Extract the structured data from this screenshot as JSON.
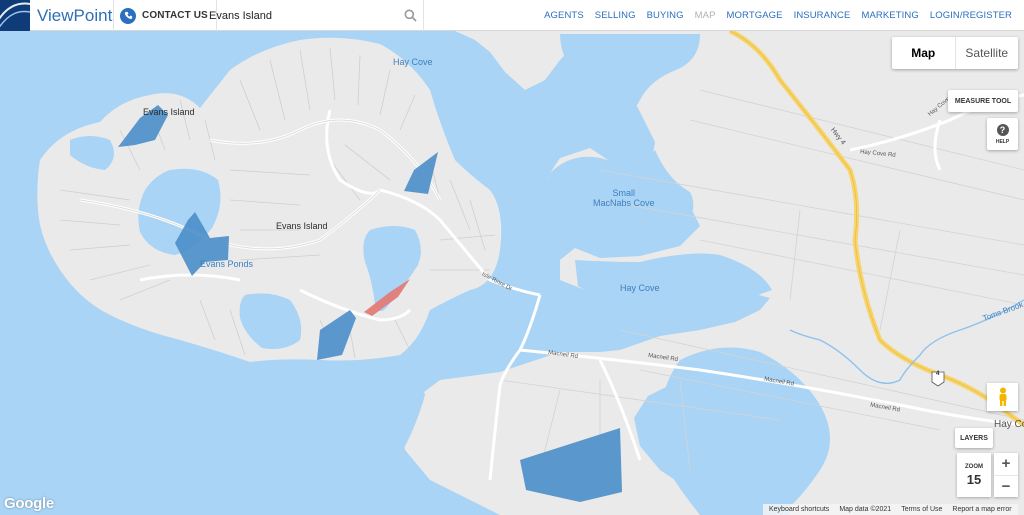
{
  "header": {
    "brand": "ViewPoint",
    "contact_label": "CONTACT US",
    "search_value": "Evans Island",
    "nav": [
      "AGENTS",
      "SELLING",
      "BUYING",
      "MAP",
      "MORTGAGE",
      "INSURANCE",
      "MARKETING",
      "LOGIN/REGISTER"
    ],
    "active_nav": "MAP"
  },
  "map": {
    "labels": {
      "evans_island_1": "Evans Island",
      "evans_island_2": "Evans Island",
      "evans_ponds": "Evans Ponds",
      "hay_cove_1": "Hay Cove",
      "hay_cove_2": "Hay Cove",
      "hay_cove_3": "Hay Cov",
      "small_macnabs_cove": "Small\nMacNabs Cove",
      "hwy": "Hwy 4",
      "hay_cove_rd_1": "Hay Cove Rd",
      "hay_cove_rd_2": "Hay Cove Rd",
      "isle_road": "Isle Rinre Dr",
      "macneil_rd_1": "Macneil Rd",
      "macneil_rd_2": "Macneil Rd",
      "macneil_rd_3": "Macneil Rd",
      "macneil_rd_4": "Macneil Rd",
      "toms_brook": "Toms Brook",
      "route_shield": "4"
    },
    "colors": {
      "water": "#a9d4f5",
      "land": "#eaeaea",
      "listing_blue": "#4a8ec9",
      "listing_red": "#e07c78",
      "highway": "#f7d56a"
    }
  },
  "controls": {
    "map_type": [
      "Map",
      "Satellite"
    ],
    "map_type_selected": "Map",
    "measure_tool": "MEASURE TOOL",
    "help": "HELP",
    "help_glyph": "?",
    "layers": "LAYERS",
    "zoom_label": "ZOOM",
    "zoom_value": "15",
    "zoom_in": "+",
    "zoom_out": "−"
  },
  "footer": {
    "google": "Google",
    "keyboard": "Keyboard shortcuts",
    "map_data": "Map data ©2021",
    "terms": "Terms of Use",
    "report": "Report a map error"
  }
}
